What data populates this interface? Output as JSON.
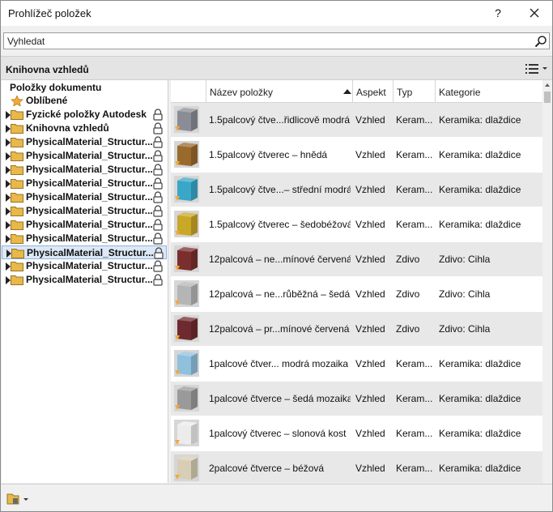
{
  "window": {
    "title": "Prohlížeč položek",
    "help_label": "?",
    "close_icon": "close-icon"
  },
  "search": {
    "placeholder": "Vyhledat",
    "icon": "search-icon"
  },
  "library_header": {
    "title": "Knihovna vzhledů",
    "view_icon": "list-view-icon"
  },
  "tree": {
    "root": "Položky dokumentu",
    "items": [
      {
        "label": "Oblíbené",
        "icon": "star-icon",
        "expandable": false,
        "locked": false
      },
      {
        "label": "Fyzické položky Autodesk",
        "icon": "folder-icon",
        "expandable": true,
        "locked": true
      },
      {
        "label": "Knihovna vzhledů",
        "icon": "folder-icon",
        "expandable": true,
        "locked": true
      },
      {
        "label": "PhysicalMaterial_Structur...",
        "icon": "folder-icon",
        "expandable": true,
        "locked": true
      },
      {
        "label": "PhysicalMaterial_Structur...",
        "icon": "folder-icon",
        "expandable": true,
        "locked": true
      },
      {
        "label": "PhysicalMaterial_Structur...",
        "icon": "folder-icon",
        "expandable": true,
        "locked": true
      },
      {
        "label": "PhysicalMaterial_Structur...",
        "icon": "folder-icon",
        "expandable": true,
        "locked": true
      },
      {
        "label": "PhysicalMaterial_Structur...",
        "icon": "folder-icon",
        "expandable": true,
        "locked": true
      },
      {
        "label": "PhysicalMaterial_Structur...",
        "icon": "folder-icon",
        "expandable": true,
        "locked": true
      },
      {
        "label": "PhysicalMaterial_Structur...",
        "icon": "folder-icon",
        "expandable": true,
        "locked": true
      },
      {
        "label": "PhysicalMaterial_Structur...",
        "icon": "folder-icon",
        "expandable": true,
        "locked": true
      },
      {
        "label": "PhysicalMaterial_Structur...",
        "icon": "folder-icon",
        "expandable": true,
        "locked": true,
        "selected": true
      },
      {
        "label": "PhysicalMaterial_Structur...",
        "icon": "folder-icon",
        "expandable": true,
        "locked": true
      },
      {
        "label": "PhysicalMaterial_Structur...",
        "icon": "folder-icon",
        "expandable": true,
        "locked": true
      }
    ]
  },
  "table": {
    "columns": [
      "Název položky",
      "Aspekt",
      "Typ",
      "Kategorie"
    ],
    "sort_column": "Název položky",
    "sort_direction": "ascending",
    "rows": [
      {
        "name": "1.5palcový čtve...řidlicově modrá",
        "aspect": "Vzhled",
        "type": "Keram...",
        "category": "Keramika: dlaždice",
        "thumb_color": "#8a8d96"
      },
      {
        "name": "1.5palcový čtverec – hnědá",
        "aspect": "Vzhled",
        "type": "Keram...",
        "category": "Keramika: dlaždice",
        "thumb_color": "#9a6a2c"
      },
      {
        "name": "1.5palcový čtve...– střední modrá",
        "aspect": "Vzhled",
        "type": "Keram...",
        "category": "Keramika: dlaždice",
        "thumb_color": "#3aa6c8"
      },
      {
        "name": "1.5palcový čtverec – šedobéžová",
        "aspect": "Vzhled",
        "type": "Keram...",
        "category": "Keramika: dlaždice",
        "thumb_color": "#c9a727"
      },
      {
        "name": "12palcová – ne...mínové červená",
        "aspect": "Vzhled",
        "type": "Zdivo",
        "category": "Zdivo: Cihla",
        "thumb_color": "#7a2e2e"
      },
      {
        "name": "12palcová – ne...růběžná – šedá",
        "aspect": "Vzhled",
        "type": "Zdivo",
        "category": "Zdivo: Cihla",
        "thumb_color": "#b5b5b5"
      },
      {
        "name": "12palcová – pr...mínové červená",
        "aspect": "Vzhled",
        "type": "Zdivo",
        "category": "Zdivo: Cihla",
        "thumb_color": "#6e2a2e"
      },
      {
        "name": "1palcové čtver... modrá mozaika",
        "aspect": "Vzhled",
        "type": "Keram...",
        "category": "Keramika: dlaždice",
        "thumb_color": "#8fc0dc"
      },
      {
        "name": "1palcové čtverce – šedá mozaika",
        "aspect": "Vzhled",
        "type": "Keram...",
        "category": "Keramika: dlaždice",
        "thumb_color": "#9a9a9a"
      },
      {
        "name": "1palcový čtverec – slonová kost",
        "aspect": "Vzhled",
        "type": "Keram...",
        "category": "Keramika: dlaždice",
        "thumb_color": "#ececec"
      },
      {
        "name": "2palcové čtverce – béžová",
        "aspect": "Vzhled",
        "type": "Keram...",
        "category": "Keramika: dlaždice",
        "thumb_color": "#d8cdb5"
      }
    ]
  },
  "footer": {
    "button_icon": "library-menu-icon"
  },
  "colors": {
    "selection": "#dce8f6",
    "alt_row": "#e8e8e8",
    "folder": "#e8b84a"
  }
}
